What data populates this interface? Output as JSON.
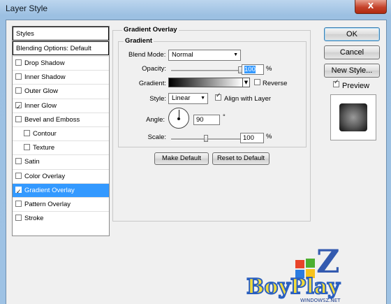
{
  "window": {
    "title": "Layer Style",
    "close_glyph": "X"
  },
  "styles_panel": {
    "header": "Styles",
    "blending": "Blending Options: Default",
    "items": [
      {
        "label": "Drop Shadow",
        "checked": false,
        "indent": false,
        "selected": false
      },
      {
        "label": "Inner Shadow",
        "checked": false,
        "indent": false,
        "selected": false
      },
      {
        "label": "Outer Glow",
        "checked": false,
        "indent": false,
        "selected": false
      },
      {
        "label": "Inner Glow",
        "checked": true,
        "indent": false,
        "selected": false
      },
      {
        "label": "Bevel and Emboss",
        "checked": false,
        "indent": false,
        "selected": false
      },
      {
        "label": "Contour",
        "checked": false,
        "indent": true,
        "selected": false
      },
      {
        "label": "Texture",
        "checked": false,
        "indent": true,
        "selected": false
      },
      {
        "label": "Satin",
        "checked": false,
        "indent": false,
        "selected": false
      },
      {
        "label": "Color Overlay",
        "checked": false,
        "indent": false,
        "selected": false
      },
      {
        "label": "Gradient Overlay",
        "checked": true,
        "indent": false,
        "selected": true
      },
      {
        "label": "Pattern Overlay",
        "checked": false,
        "indent": false,
        "selected": false
      },
      {
        "label": "Stroke",
        "checked": false,
        "indent": false,
        "selected": false
      }
    ]
  },
  "gradient_overlay": {
    "section_title": "Gradient Overlay",
    "group_title": "Gradient",
    "blend_mode_label": "Blend Mode:",
    "blend_mode_value": "Normal",
    "opacity_label": "Opacity:",
    "opacity_value": "100",
    "opacity_unit": "%",
    "opacity_level": 1.0,
    "gradient_label": "Gradient:",
    "reverse_label": "Reverse",
    "reverse_checked": false,
    "style_label": "Style:",
    "style_value": "Linear",
    "align_label": "Align with Layer",
    "align_checked": true,
    "angle_label": "Angle:",
    "angle_value": "90",
    "angle_unit": "°",
    "scale_label": "Scale:",
    "scale_value": "100",
    "scale_unit": "%",
    "scale_level": 0.5,
    "make_default": "Make Default",
    "reset_default": "Reset to Default"
  },
  "buttons": {
    "ok": "OK",
    "cancel": "Cancel",
    "new_style": "New Style..."
  },
  "preview": {
    "label": "Preview",
    "checked": true
  },
  "watermark": {
    "text": "BoyPlay",
    "sub": "WINDOWSZ.NET"
  },
  "colors": {
    "selection": "#3399ff",
    "title_gradient_top": "#bcd6ee",
    "close": "#c4422a"
  },
  "icons": {
    "close": "close-icon",
    "dropdown": "chevron-down-icon",
    "angle": "angle-dial-icon"
  }
}
